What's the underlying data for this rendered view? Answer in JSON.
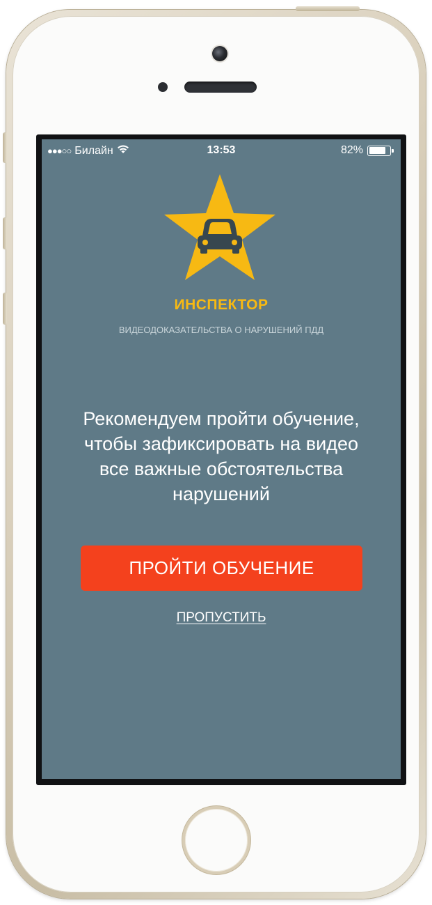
{
  "status_bar": {
    "signal": "●●●○○",
    "carrier": "Билайн",
    "time": "13:53",
    "battery_percent": "82%",
    "battery_level": 0.82,
    "wifi_icon": "wifi-icon"
  },
  "logo": {
    "icon": "star-car-icon",
    "star_color": "#f7b913",
    "car_color": "#37474f"
  },
  "app": {
    "title": "ИНСПЕКТОР",
    "subtitle": "ВИДЕОДОКАЗАТЕЛЬСТВА О НАРУШЕНИЙ ПДД"
  },
  "onboarding": {
    "message_lines": [
      "Рекомендуем пройти обучение,",
      "чтобы зафиксировать на видео",
      "все важные обстоятельства",
      "нарушений"
    ],
    "primary_button": "ПРОЙТИ ОБУЧЕНИЕ",
    "skip_link": "ПРОПУСТИТЬ"
  },
  "colors": {
    "screen_background": "#5f7a87",
    "accent_yellow": "#f7b913",
    "button_red": "#f4411d"
  }
}
